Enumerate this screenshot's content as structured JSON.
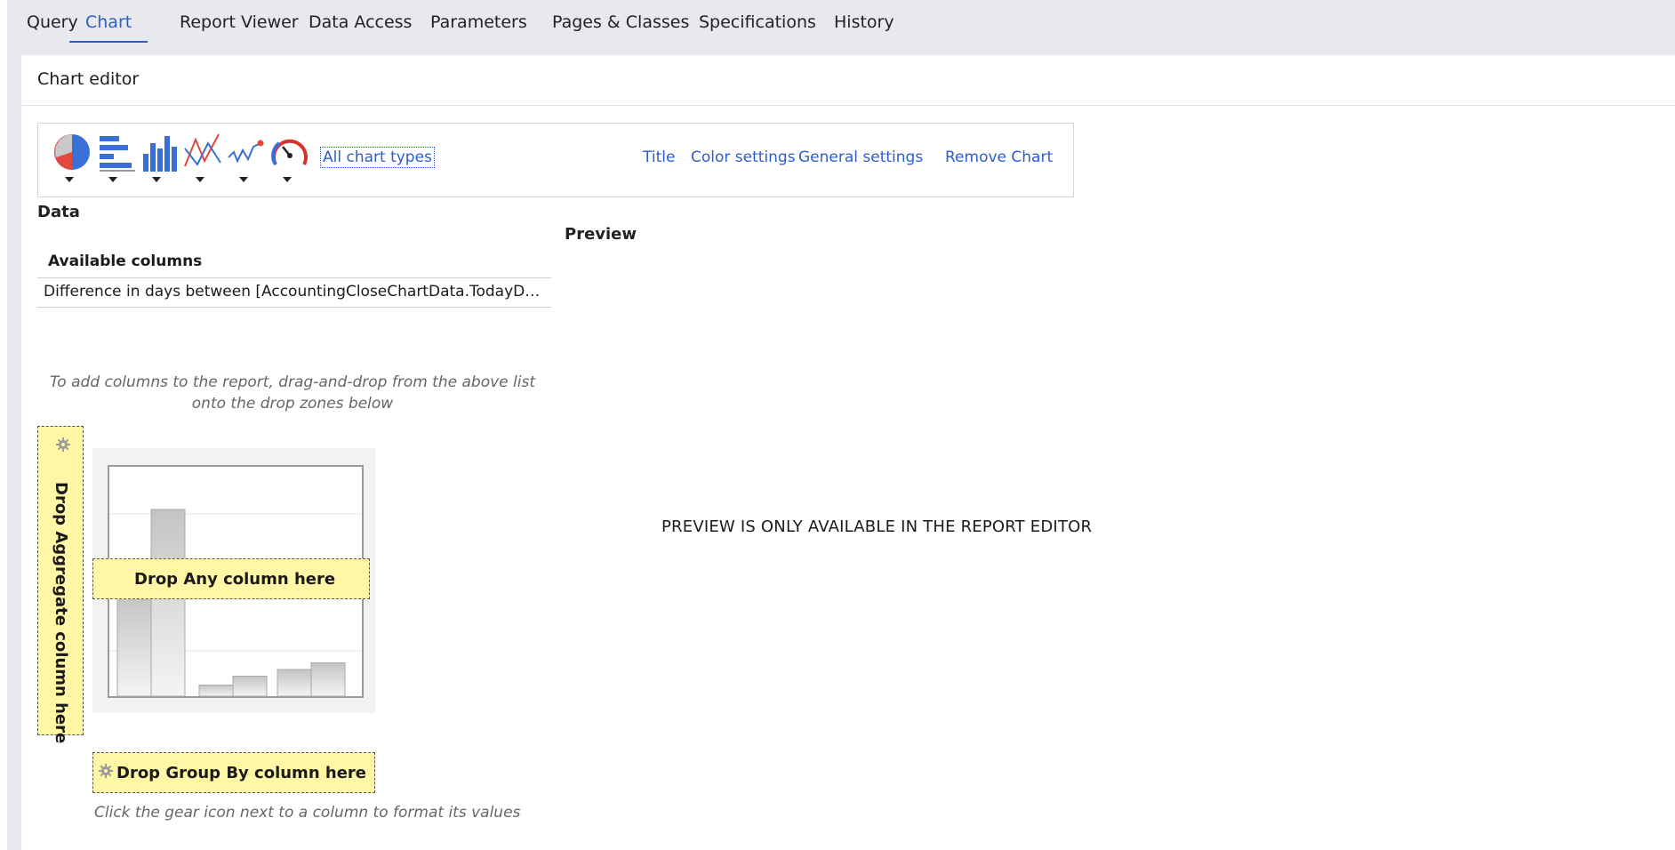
{
  "tabs": [
    {
      "label": "Query",
      "active": false
    },
    {
      "label": "Chart",
      "active": true
    },
    {
      "label": "Report Viewer",
      "active": false
    },
    {
      "label": "Data Access",
      "active": false
    },
    {
      "label": "Parameters",
      "active": false
    },
    {
      "label": "Pages & Classes",
      "active": false
    },
    {
      "label": "Specifications",
      "active": false
    },
    {
      "label": "History",
      "active": false
    }
  ],
  "panel": {
    "title": "Chart editor"
  },
  "toolbar": {
    "chart_type_icons": [
      "pie-chart-icon",
      "horizontal-bar-chart-icon",
      "column-chart-icon",
      "line-chart-icon",
      "sparkline-chart-icon",
      "gauge-chart-icon"
    ],
    "all_chart_types": "All chart types",
    "title_link": "Title",
    "color_settings_link": "Color settings",
    "general_settings_link": "General settings",
    "remove_chart_link": "Remove Chart"
  },
  "data_section": {
    "label": "Data",
    "available_columns_header": "Available columns",
    "columns": [
      "Difference in days between [AccountingCloseChartData.TodayDat..."
    ],
    "hint": "To add columns to the report, drag-and-drop from the above list onto the drop zones below",
    "drop_aggregate": "Drop Aggregate column here",
    "drop_any": "Drop Any column here",
    "drop_group_by": "Drop Group By column here",
    "gear_hint": "Click the gear icon next to a column to format its values"
  },
  "preview": {
    "label": "Preview",
    "message": "PREVIEW IS ONLY AVAILABLE IN THE REPORT EDITOR"
  },
  "colors": {
    "accent": "#2c5fc9",
    "drop_zone": "#fff6a6",
    "pie_red": "#e2483d",
    "pie_blue": "#3b6fd8",
    "gauge_red": "#d9322b"
  },
  "placeholder_chart": {
    "bar_levels": [
      0.45,
      0.84,
      0.05,
      0.09,
      0.12,
      0.15
    ]
  }
}
